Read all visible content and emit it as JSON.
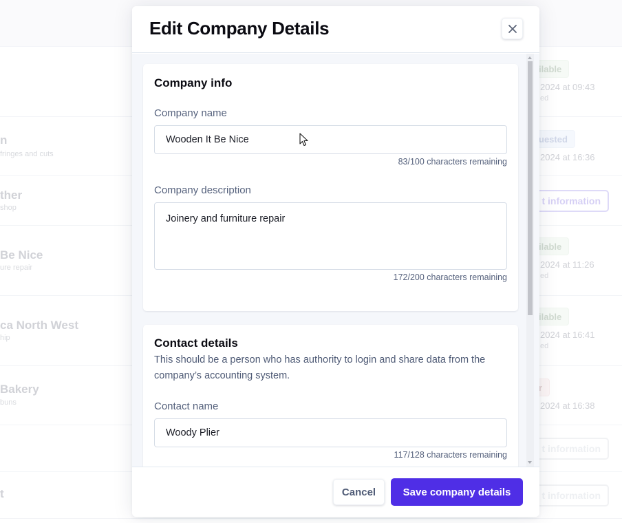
{
  "background": {
    "rows": [
      {
        "name": "",
        "subtitle": "",
        "badge": "ilable",
        "badge_tone": "green",
        "date": "2024 at 09:43",
        "note": "ed"
      },
      {
        "name": "n",
        "subtitle": "fringes and cuts",
        "badge": "uested",
        "badge_tone": "blue",
        "date": "2024 at 16:36",
        "note": ""
      },
      {
        "name": "ther",
        "subtitle": "shop",
        "button": "t information"
      },
      {
        "name": "Be Nice",
        "subtitle": "ure repair",
        "badge": "ilable",
        "badge_tone": "green",
        "date": "2024 at 11:26",
        "note": "ed"
      },
      {
        "name": "ca North West",
        "subtitle": "hip",
        "badge": "ilable",
        "badge_tone": "green",
        "date": "2024 at 16:41",
        "note": "ed"
      },
      {
        "name": "Bakery",
        "subtitle": "buns",
        "badge": "r",
        "badge_tone": "red",
        "date": "2024 at 16:38",
        "note": ""
      },
      {
        "name": "",
        "subtitle": "",
        "button": "t information"
      },
      {
        "name": "t",
        "subtitle": "",
        "button": "t information"
      }
    ]
  },
  "modal": {
    "title": "Edit Company Details",
    "close_icon": "close-icon",
    "company_info": {
      "title": "Company info",
      "company_name": {
        "label": "Company name",
        "value": "Wooden It Be Nice",
        "counter": "83/100 characters remaining"
      },
      "company_description": {
        "label": "Company description",
        "value": "Joinery and furniture repair",
        "counter": "172/200 characters remaining"
      }
    },
    "contact_details": {
      "title": "Contact details",
      "description": "This should be a person who has authority to login and share data from the company’s accounting system.",
      "contact_name": {
        "label": "Contact name",
        "value": "Woody Plier",
        "counter": "117/128 characters remaining"
      }
    },
    "footer": {
      "cancel_label": "Cancel",
      "save_label": "Save company details"
    }
  },
  "colors": {
    "primary": "#4f2ee6",
    "label": "#56627d",
    "title": "#0b0b12"
  }
}
